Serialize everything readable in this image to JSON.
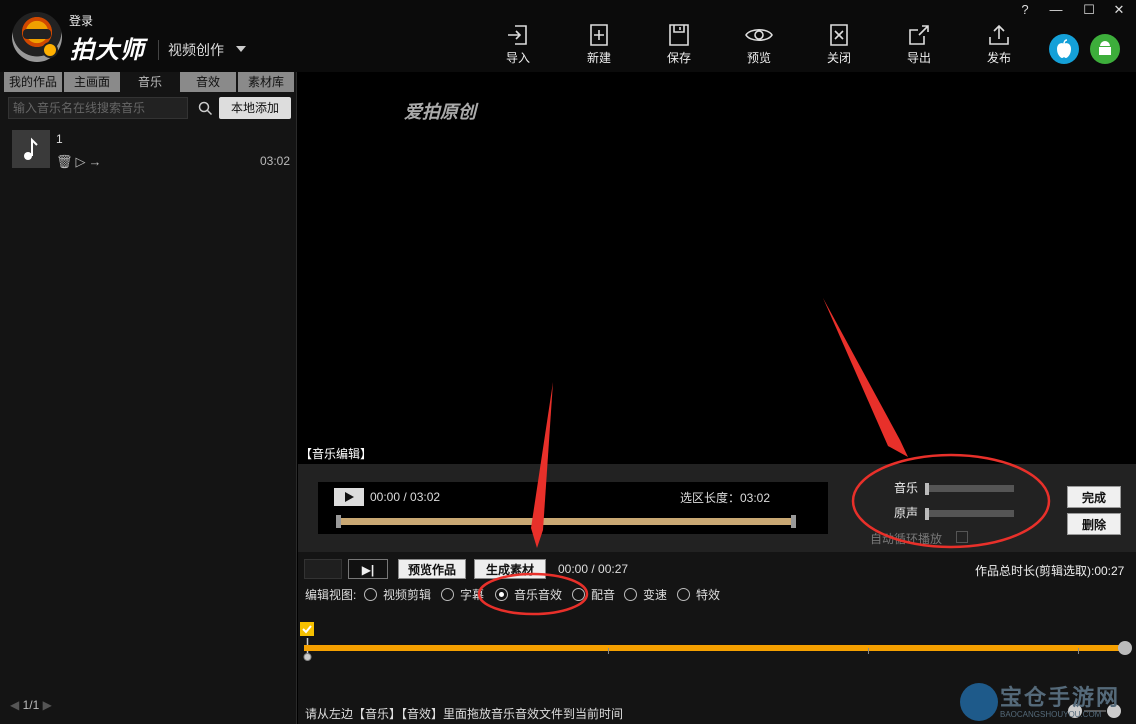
{
  "header": {
    "login": "登录",
    "app_name": "拍大师",
    "mode": "视频创作",
    "tools": [
      "导入",
      "新建",
      "保存",
      "预览",
      "关闭",
      "导出",
      "发布"
    ],
    "window_controls": [
      "?",
      "—",
      "☐",
      "✕"
    ]
  },
  "left_panel": {
    "tabs": [
      {
        "label": "我的作品",
        "active": false
      },
      {
        "label": "主画面",
        "active": false
      },
      {
        "label": "音乐",
        "active": true
      },
      {
        "label": "音效",
        "active": false
      },
      {
        "label": "素材库",
        "active": false
      }
    ],
    "search_placeholder": "输入音乐名在线搜索音乐",
    "add_local": "本地添加",
    "music_item": {
      "name": "1",
      "duration": "03:02"
    },
    "pager": "1/1"
  },
  "preview": {
    "watermark": "爱拍原创"
  },
  "music_edit": {
    "title": "【音乐编辑】",
    "time": "00:00 / 03:02",
    "selection": "选区长度：03:02",
    "music_label": "音乐",
    "original_label": "原声",
    "loop_label": "自动循环播放",
    "done": "完成",
    "delete": "删除"
  },
  "toolbar": {
    "step": "▶|",
    "preview_work": "预览作品",
    "generate": "生成素材",
    "time": "00:00 / 00:27",
    "total": "作品总时长(剪辑选取):00:27"
  },
  "edit_view": {
    "label": "编辑视图:",
    "options": [
      {
        "label": "视频剪辑",
        "selected": false
      },
      {
        "label": "字幕",
        "selected": false
      },
      {
        "label": "音乐音效",
        "selected": true
      },
      {
        "label": "配音",
        "selected": false
      },
      {
        "label": "变速",
        "selected": false
      },
      {
        "label": "特效",
        "selected": false
      }
    ]
  },
  "hint": "请从左边【音乐】【音效】里面拖放音乐音效文件到当前时间",
  "site_watermark": {
    "name": "宝仓手游网",
    "url": "BAOCANGSHOUYOU.COM"
  },
  "colors": {
    "accent": "#f5a000",
    "annotation": "#e8302a",
    "track": "#c9a873"
  }
}
